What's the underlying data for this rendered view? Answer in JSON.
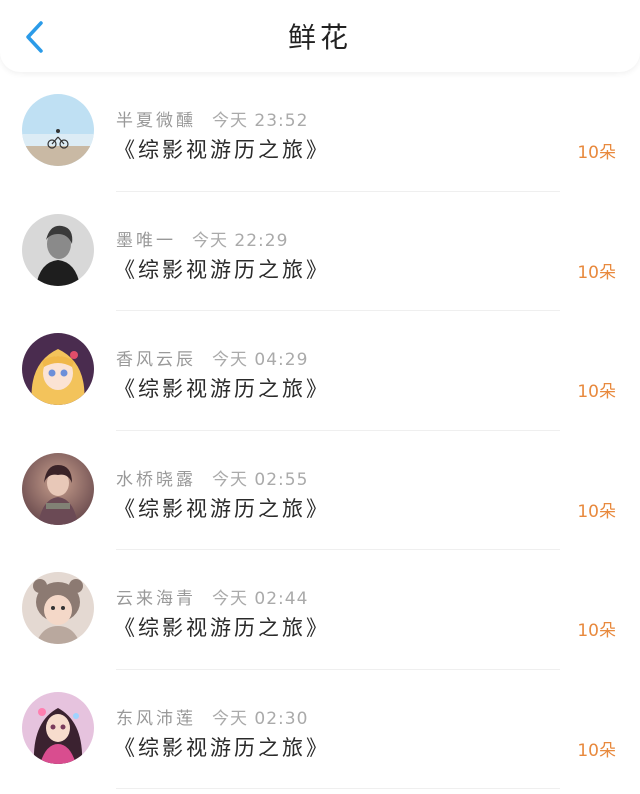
{
  "header": {
    "title": "鲜花"
  },
  "items": [
    {
      "name": "半夏微醺",
      "time": "今天 23:52",
      "book": "《综影视游历之旅》",
      "amount": "10朵"
    },
    {
      "name": "墨唯一",
      "time": "今天 22:29",
      "book": "《综影视游历之旅》",
      "amount": "10朵"
    },
    {
      "name": "香风云辰",
      "time": "今天 04:29",
      "book": "《综影视游历之旅》",
      "amount": "10朵"
    },
    {
      "name": "水桥晓露",
      "time": "今天 02:55",
      "book": "《综影视游历之旅》",
      "amount": "10朵"
    },
    {
      "name": "云来海青",
      "time": "今天 02:44",
      "book": "《综影视游历之旅》",
      "amount": "10朵"
    },
    {
      "name": "东风沛莲",
      "time": "今天 02:30",
      "book": "《综影视游历之旅》",
      "amount": "10朵"
    }
  ],
  "colors": {
    "back_arrow": "#2b9be8",
    "amount": "#e8893d"
  }
}
